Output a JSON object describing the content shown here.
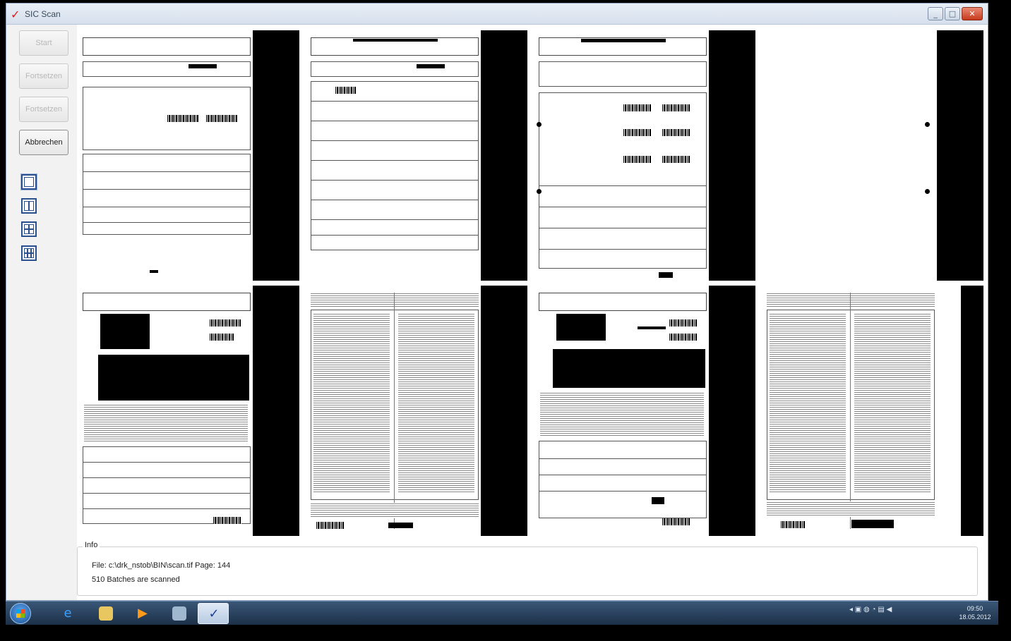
{
  "window": {
    "title": "SIC Scan"
  },
  "left_panel": {
    "buttons": [
      {
        "label": "Start",
        "enabled": false
      },
      {
        "label": "Fortsetzen",
        "enabled": false
      },
      {
        "label": "Fortsetzen",
        "enabled": false
      },
      {
        "label": "Abbrechen",
        "enabled": true
      }
    ],
    "layout_options": [
      "layout-1x1",
      "layout-1x2",
      "layout-2x2",
      "layout-2x3"
    ]
  },
  "info": {
    "label": "Info",
    "file_line": "File: c:\\drk_nstob\\BIN\\scan.tif Page: 144",
    "status_line": "510 Batches are scanned"
  },
  "taskbar": {
    "apps": [
      "windows-explorer",
      "internet-explorer",
      "file-explorer",
      "media-player",
      "scanner-app",
      "sic-scan"
    ],
    "clock_time": "09:50",
    "clock_date": "18.05.2012"
  }
}
